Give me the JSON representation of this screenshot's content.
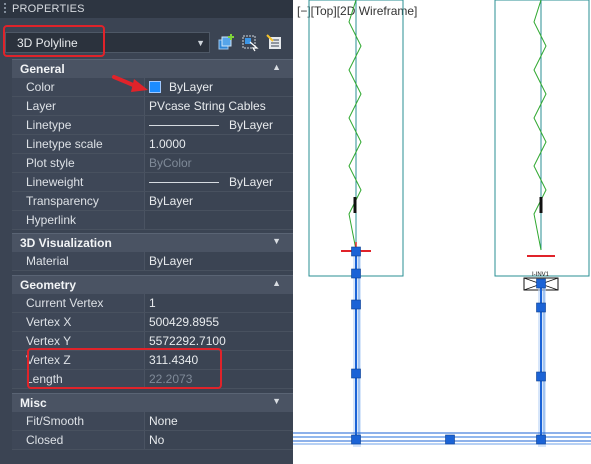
{
  "palette": {
    "title": "PROPERTIES",
    "object_type": "3D Polyline",
    "toolbar": [
      "toggle-pickadd-icon",
      "select-objects-icon",
      "quick-select-icon"
    ]
  },
  "sections": {
    "general": "General",
    "visualization": "3D Visualization",
    "geometry": "Geometry",
    "misc": "Misc"
  },
  "general": {
    "color_label": "Color",
    "color_value": "ByLayer",
    "color_hex": "#1c8cff",
    "layer_label": "Layer",
    "layer_value": "PVcase String Cables",
    "linetype_label": "Linetype",
    "linetype_value": "ByLayer",
    "linetype_scale_label": "Linetype scale",
    "linetype_scale_value": "1.0000",
    "plot_style_label": "Plot style",
    "plot_style_value": "ByColor",
    "lineweight_label": "Lineweight",
    "lineweight_value": "ByLayer",
    "transparency_label": "Transparency",
    "transparency_value": "ByLayer",
    "hyperlink_label": "Hyperlink",
    "hyperlink_value": ""
  },
  "visualization": {
    "material_label": "Material",
    "material_value": "ByLayer"
  },
  "geometry": {
    "current_vertex_label": "Current Vertex",
    "current_vertex_value": "1",
    "vertex_x_label": "Vertex X",
    "vertex_x_value": "500429.8955",
    "vertex_y_label": "Vertex Y",
    "vertex_y_value": "5572292.7100",
    "vertex_z_label": "Vertex Z",
    "vertex_z_value": "311.4340",
    "length_label": "Length",
    "length_value": "22.2073"
  },
  "misc": {
    "fit_label": "Fit/Smooth",
    "fit_value": "None",
    "closed_label": "Closed",
    "closed_value": "No"
  },
  "viewport": {
    "label": "[−][Top][2D Wireframe]",
    "inverter_label": "I-INV1"
  },
  "colors": {
    "palette_bg": "#3b4453",
    "highlight_red": "#e0232a",
    "selection_blue": "#1b63d6",
    "wire_green": "#2fa82f",
    "table_teal": "#2a8f93"
  }
}
